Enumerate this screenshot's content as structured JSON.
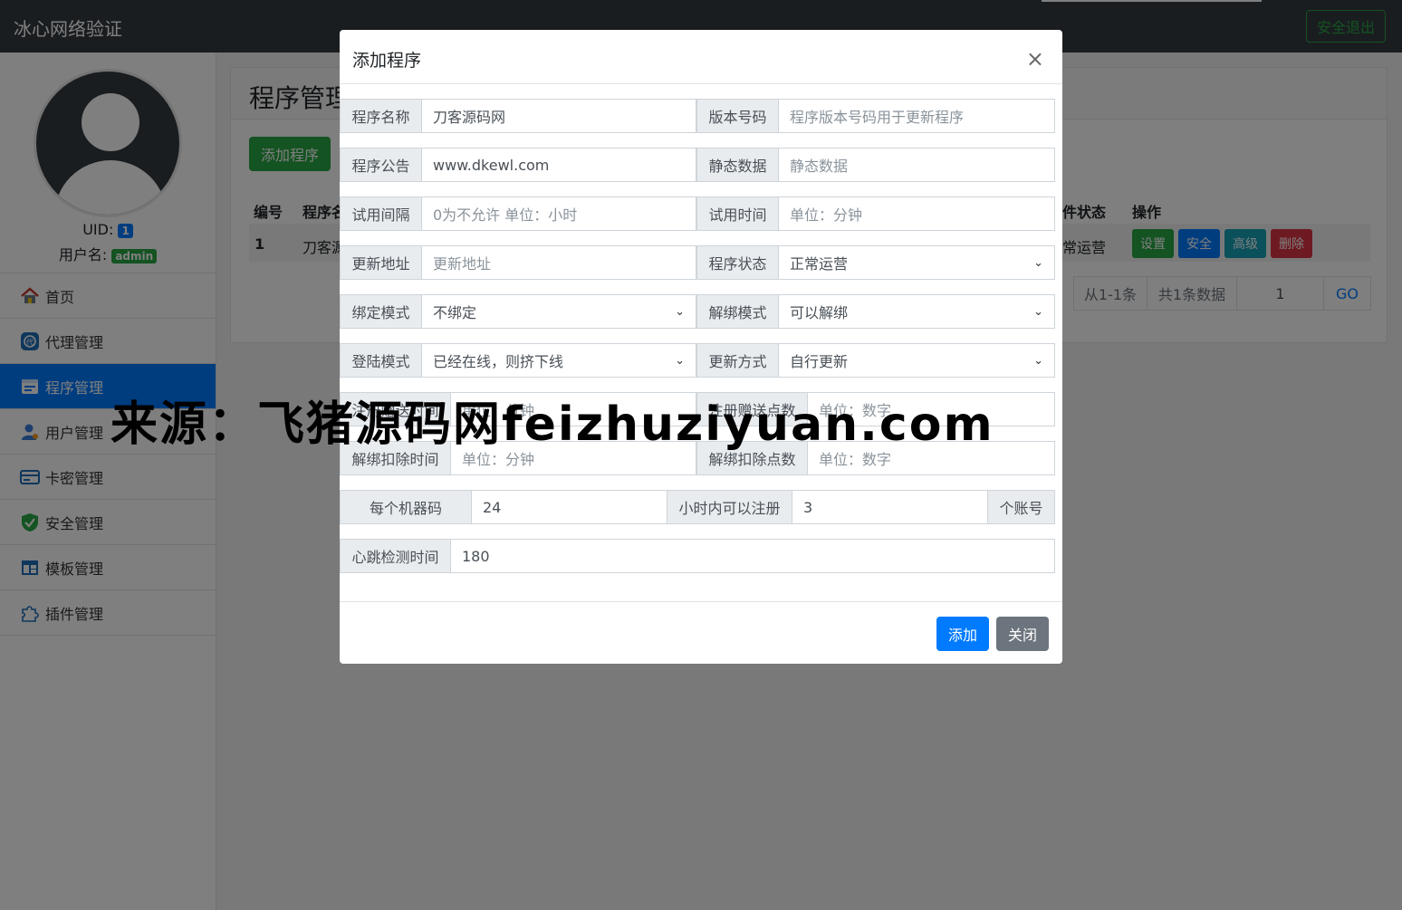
{
  "navbar": {
    "brand": "冰心网络验证",
    "logout": "安全退出"
  },
  "sidebar": {
    "uid_label": "UID:",
    "uid_value": "1",
    "user_label": "用户名:",
    "user_value": "admin",
    "items": [
      {
        "label": "首页",
        "icon": "home-icon"
      },
      {
        "label": "代理管理",
        "icon": "agent-icon"
      },
      {
        "label": "程序管理",
        "icon": "program-icon"
      },
      {
        "label": "用户管理",
        "icon": "user-icon"
      },
      {
        "label": "卡密管理",
        "icon": "card-icon"
      },
      {
        "label": "安全管理",
        "icon": "shield-icon"
      },
      {
        "label": "模板管理",
        "icon": "template-icon"
      },
      {
        "label": "插件管理",
        "icon": "puzzle-icon"
      }
    ],
    "active_index": 2
  },
  "main": {
    "title": "程序管理",
    "add_button": "添加程序",
    "columns": {
      "id": "编号",
      "name": "程序名",
      "status": "件状态",
      "ops": "操作"
    },
    "row": {
      "id": "1",
      "name": "刀客源",
      "status": "常运营"
    },
    "ops": {
      "settings": "设置",
      "security": "安全",
      "advanced": "高级",
      "delete": "删除"
    },
    "pager": {
      "range": "从1-1条",
      "total": "共1条数据",
      "page": "1",
      "go": "GO"
    }
  },
  "modal": {
    "title": "添加程序",
    "close_symbol": "×",
    "fields": {
      "name": {
        "label": "程序名称",
        "value": "刀客源码网"
      },
      "version": {
        "label": "版本号码",
        "placeholder": "程序版本号码用于更新程序"
      },
      "notice": {
        "label": "程序公告",
        "value": "www.dkewl.com"
      },
      "static": {
        "label": "静态数据",
        "placeholder": "静态数据"
      },
      "trial_interval": {
        "label": "试用间隔",
        "placeholder": "0为不允许 单位：小时"
      },
      "trial_time": {
        "label": "试用时间",
        "placeholder": "单位：分钟"
      },
      "update_url": {
        "label": "更新地址",
        "placeholder": "更新地址"
      },
      "status": {
        "label": "程序状态",
        "selected": "正常运营"
      },
      "bind_mode": {
        "label": "绑定模式",
        "selected": "不绑定"
      },
      "unbind_mode": {
        "label": "解绑模式",
        "selected": "可以解绑"
      },
      "login_mode": {
        "label": "登陆模式",
        "selected": "已经在线，则挤下线"
      },
      "update_mode": {
        "label": "更新方式",
        "selected": "自行更新"
      },
      "reg_gift_time": {
        "label": "注册赠送时间",
        "placeholder": "单位：分钟"
      },
      "reg_gift_points": {
        "label": "注册赠送点数",
        "placeholder": "单位：数字"
      },
      "unbind_time": {
        "label": "解绑扣除时间",
        "placeholder": "单位：分钟"
      },
      "unbind_points": {
        "label": "解绑扣除点数",
        "placeholder": "单位：数字"
      },
      "per_machine": {
        "label": "每个机器码",
        "value": "24",
        "mid_label": "小时内可以注册",
        "count": "3",
        "suffix": "个账号"
      },
      "heartbeat": {
        "label": "心跳检测时间",
        "value": "180"
      }
    },
    "footer": {
      "add": "添加",
      "close": "关闭"
    }
  },
  "watermark": "来源：飞猪源码网feizhuziyuan.com",
  "colors": {
    "primary": "#007bff",
    "success": "#28a745",
    "info": "#17a2b8",
    "danger": "#dc3545",
    "secondary": "#6c757d",
    "navbar": "#343a40"
  }
}
